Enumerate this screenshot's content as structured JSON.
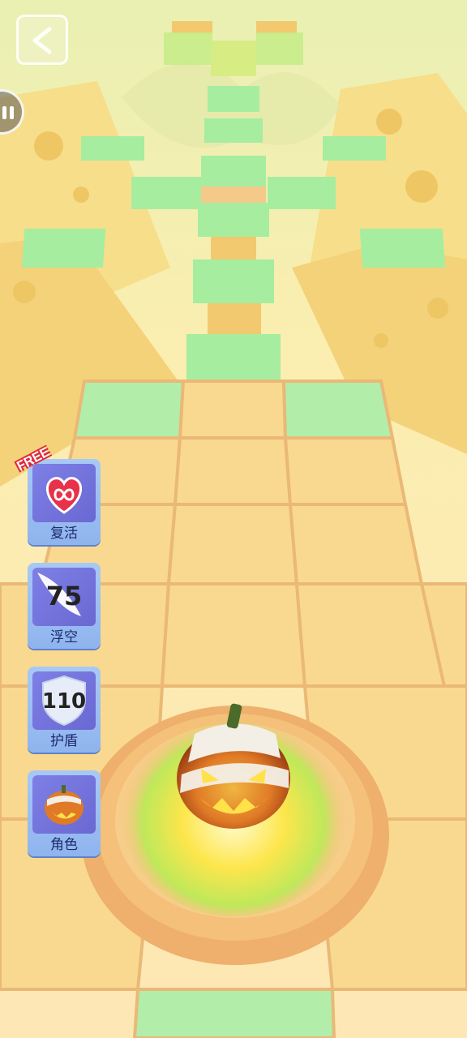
{
  "powerups": [
    {
      "id": "revive",
      "badge": "FREE",
      "label": "复活",
      "icon": "infinity-heart-icon"
    },
    {
      "id": "float",
      "count": "75",
      "label": "浮空",
      "icon": "wing-icon"
    },
    {
      "id": "shield",
      "count": "110",
      "label": "护盾",
      "icon": "shield-icon"
    },
    {
      "id": "character",
      "label": "角色",
      "icon": "pumpkin-icon"
    }
  ],
  "colors": {
    "tile": "#f9d98f",
    "tile_edge": "#e9b772",
    "green_tile": "#a6eda0",
    "platform": "#f4c07a",
    "sky": "#fdf4c4"
  }
}
